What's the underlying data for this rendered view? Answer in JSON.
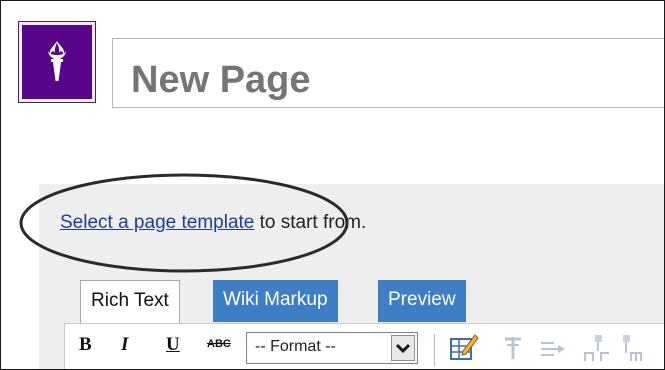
{
  "page_title": {
    "placeholder": "New Page"
  },
  "template_prompt": {
    "link_text": "Select a page template",
    "suffix": " to start from."
  },
  "tabs": [
    {
      "label": "Rich Text",
      "active": true
    },
    {
      "label": "Wiki Markup",
      "active": false
    },
    {
      "label": "Preview",
      "active": false
    }
  ],
  "toolbar": {
    "bold_label": "B",
    "italic_label": "I",
    "underline_label": "U",
    "strikethrough_label": "ABC",
    "format_select": {
      "selected": "-- Format --"
    }
  },
  "colors": {
    "brand_purple": "#57068c",
    "tab_blue": "#3d7ec4",
    "link_blue": "#1d3d9a",
    "panel_gray": "#eeeeee"
  },
  "icons": [
    "torch-logo-icon",
    "chevron-down-icon",
    "table-edit-icon",
    "insert-row-icon",
    "insert-column-icon",
    "merge-cells-icon",
    "split-cells-icon"
  ]
}
